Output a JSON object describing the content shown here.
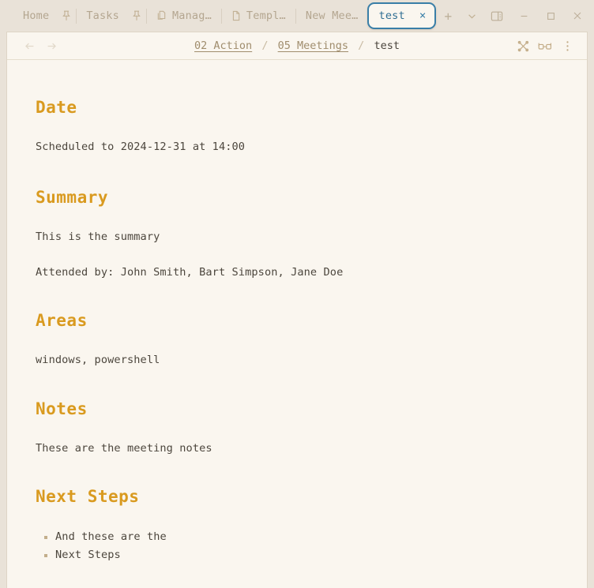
{
  "window": {
    "tabs": [
      {
        "label": "Home",
        "icon": "",
        "pinned": true,
        "active": false
      },
      {
        "label": "Tasks",
        "icon": "",
        "pinned": true,
        "active": false
      },
      {
        "label": "Manag…",
        "icon": "copy-icon",
        "pinned": false,
        "active": false
      },
      {
        "label": "Templ…",
        "icon": "file-icon",
        "pinned": false,
        "active": false
      },
      {
        "label": "New Mee…",
        "icon": "",
        "pinned": false,
        "active": false
      },
      {
        "label": "test",
        "icon": "",
        "pinned": false,
        "active": true,
        "close_label": "×"
      }
    ],
    "controls": {
      "new_tab": "+",
      "tab_list": "chevron-down-icon",
      "toggle_sidebar": "sidebar-icon",
      "minimize": "−",
      "maximize": "□",
      "close": "✕"
    },
    "colors": {
      "titlebar_bg": "#e9e2d8",
      "page_bg": "#faf6ef",
      "active_tab_border": "#3a7fa8",
      "active_tab_text": "#2f6e93",
      "heading": "#d99a1f",
      "body_text": "#4c463d",
      "link": "#a08d6d"
    }
  },
  "navbar": {
    "back": "←",
    "forward": "→",
    "breadcrumb": {
      "items": [
        {
          "label": "02 Action",
          "link": true
        },
        {
          "label": "05 Meetings",
          "link": true
        },
        {
          "label": "test",
          "link": false
        }
      ],
      "separator": "/"
    },
    "tools": [
      {
        "name": "shuffle-icon"
      },
      {
        "name": "reading-glasses-icon"
      },
      {
        "name": "more-vertical-icon"
      }
    ]
  },
  "document": {
    "sections": [
      {
        "heading": "Date",
        "paragraphs": [
          "Scheduled to 2024-12-31 at 14:00"
        ]
      },
      {
        "heading": "Summary",
        "paragraphs": [
          "This is the summary",
          "Attended by: John Smith, Bart Simpson, Jane Doe"
        ]
      },
      {
        "heading": "Areas",
        "paragraphs": [
          "windows, powershell"
        ]
      },
      {
        "heading": "Notes",
        "paragraphs": [
          "These are the meeting notes"
        ]
      },
      {
        "heading": "Next Steps",
        "bullets": [
          "And these are the",
          "Next Steps"
        ]
      }
    ]
  }
}
